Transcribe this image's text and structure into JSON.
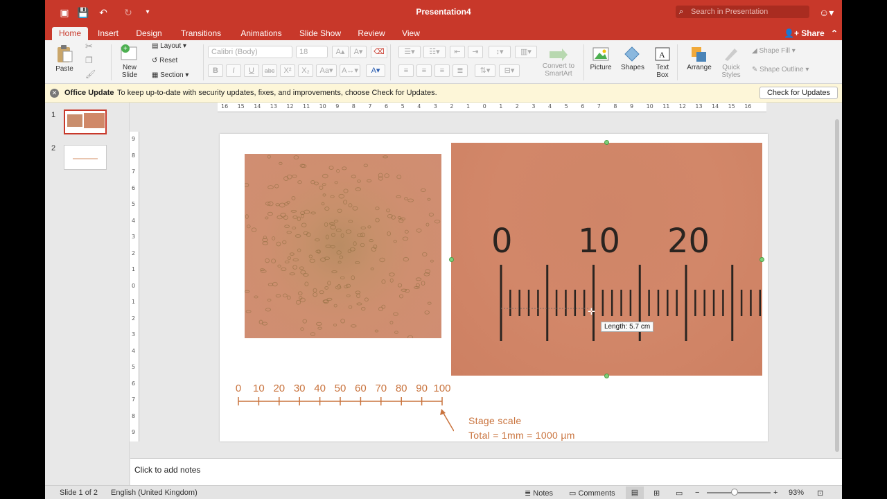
{
  "window": {
    "title": "Presentation4",
    "search_placeholder": "Search in Presentation"
  },
  "tabs": [
    "Home",
    "Insert",
    "Design",
    "Transitions",
    "Animations",
    "Slide Show",
    "Review",
    "View"
  ],
  "share_label": "Share",
  "ribbon": {
    "paste": "Paste",
    "new_slide": [
      "New",
      "Slide"
    ],
    "layout": "Layout",
    "reset": "Reset",
    "section": "Section",
    "font_name": "Calibri (Body)",
    "font_size": "18",
    "convert": [
      "Convert to",
      "SmartArt"
    ],
    "picture": "Picture",
    "shapes": "Shapes",
    "textbox": [
      "Text",
      "Box"
    ],
    "arrange": "Arrange",
    "quick_styles": [
      "Quick",
      "Styles"
    ],
    "shape_fill": "Shape Fill",
    "shape_outline": "Shape Outline",
    "format_buttons": [
      "B",
      "I",
      "U",
      "abc",
      "X²",
      "X₂"
    ]
  },
  "update_bar": {
    "title": "Office Update",
    "message": "To keep up-to-date with security updates, fixes, and improvements, choose Check for Updates.",
    "button": "Check for Updates"
  },
  "thumbnails": [
    "1",
    "2"
  ],
  "ruler": {
    "h_labels": [
      "16",
      "15",
      "14",
      "13",
      "12",
      "11",
      "10",
      "9",
      "8",
      "7",
      "6",
      "5",
      "4",
      "3",
      "2",
      "1",
      "0",
      "1",
      "2",
      "3",
      "4",
      "5",
      "6",
      "7",
      "8",
      "9",
      "10",
      "11",
      "12",
      "13",
      "14",
      "15",
      "16"
    ],
    "v_labels": [
      "9",
      "8",
      "7",
      "6",
      "5",
      "4",
      "3",
      "2",
      "1",
      "0",
      "1",
      "2",
      "3",
      "4",
      "5",
      "6",
      "7",
      "8",
      "9"
    ]
  },
  "slide": {
    "micro_numbers": [
      "0",
      "10",
      "20"
    ],
    "tooltip": "Length: 5.7 cm",
    "scale_numbers": [
      "0",
      "10",
      "20",
      "30",
      "40",
      "50",
      "60",
      "70",
      "80",
      "90",
      "100"
    ],
    "stage_label": "Stage scale",
    "stage_total": "Total = 1mm = 1000 µm"
  },
  "notes_placeholder": "Click to add notes",
  "status": {
    "slide_of": "Slide 1 of 2",
    "language": "English (United Kingdom)",
    "notes": "Notes",
    "comments": "Comments",
    "zoom": "93%"
  }
}
